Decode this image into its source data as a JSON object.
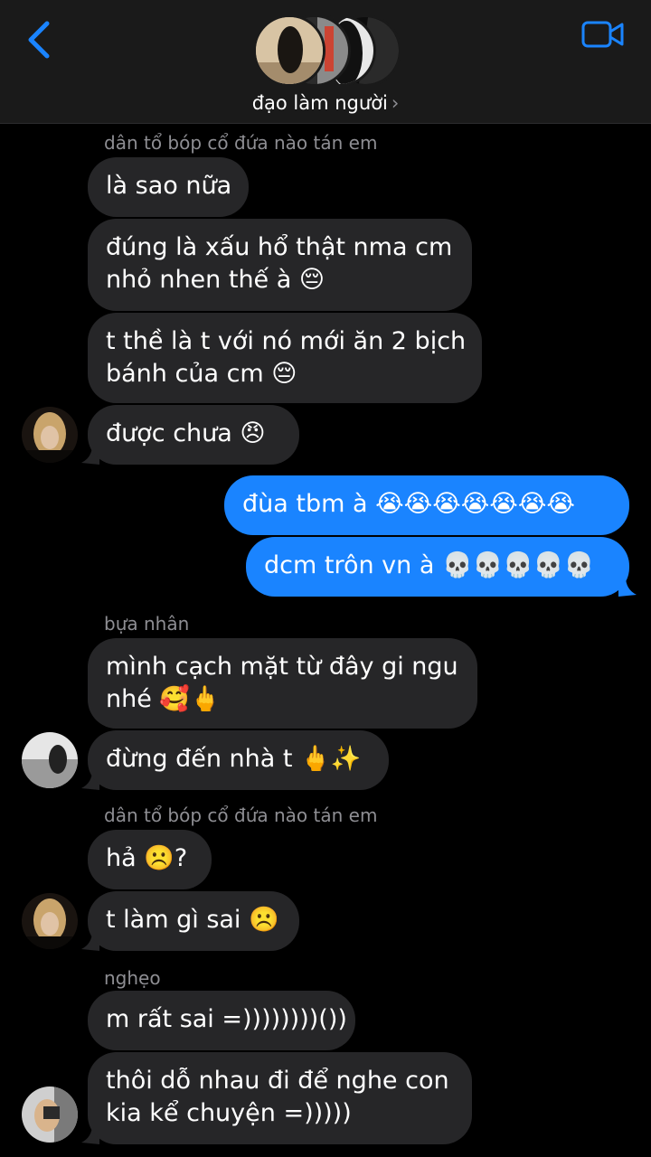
{
  "header": {
    "group_name": "đạo làm người",
    "chevron": "›",
    "back_icon": "chevron-left-icon",
    "video_icon": "video-camera-icon",
    "accent": "#1a84ff"
  },
  "messages": {
    "s1": "dân tổ bóp cổ đứa nào tán em",
    "m1": "là sao nữa",
    "m2a": "đúng là xấu hổ thật nma cm",
    "m2b": "nhỏ nhen thế à 😔",
    "m3a": "t thề là t với nó mới ăn 2 bịch",
    "m3b": "bánh của cm 😔",
    "m4": "được chưa 😠",
    "o1": "đùa tbm à 😭😭😭😭😭😭😭",
    "o2": "dcm trôn vn à 💀💀💀💀💀",
    "s2": "bựa nhân",
    "m5a": "mình cạch mặt từ đây gi ngu",
    "m5b": "nhé 🥰🖕",
    "m6": "đừng đến nhà t 🖕✨",
    "s3": "dân tổ bóp cổ đứa nào tán em",
    "m7": "hả ☹️?",
    "m8": "t làm gì sai ☹️",
    "s4": "nghẹo",
    "m9": "m rất sai =))))))))())",
    "m10a": "thôi dỗ nhau đi để nghe con",
    "m10b": "kia kể chuyện =)))))"
  },
  "colors": {
    "incoming_bubble": "#262628",
    "outgoing_bubble": "#1a84ff",
    "background": "#000000",
    "header_bg": "#1a1a1a"
  }
}
